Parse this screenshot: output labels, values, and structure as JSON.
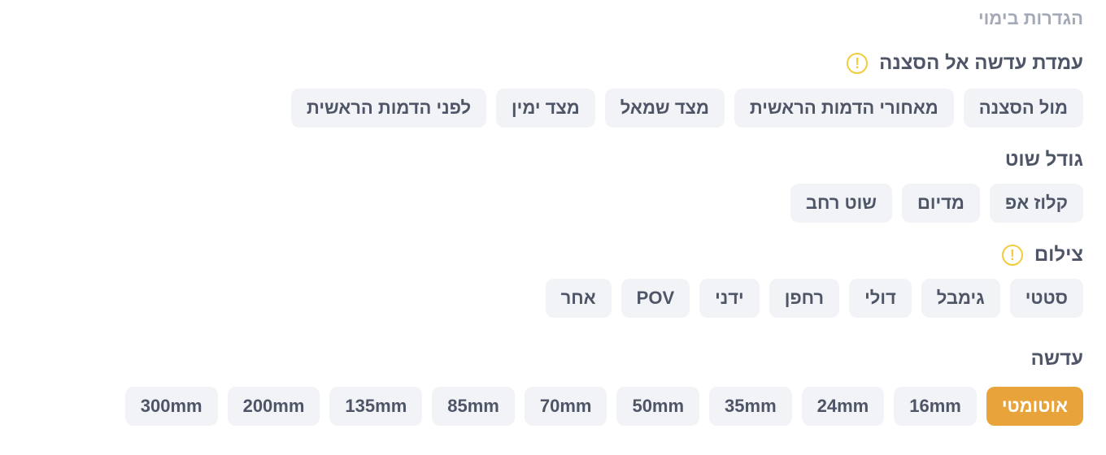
{
  "section_title": "הגדרות בימוי",
  "camera_position": {
    "label": "עמדת עדשה אל הסצנה",
    "warning_icon": "exclamation-circle-icon",
    "options": [
      "מול הסצנה",
      "מאחורי הדמות הראשית",
      "מצד שמאל",
      "מצד ימין",
      "לפני הדמות הראשית"
    ]
  },
  "shot_size": {
    "label": "גודל שוט",
    "options": [
      "קלוז אפ",
      "מדיום",
      "שוט רחב"
    ]
  },
  "filming": {
    "label": "צילום",
    "warning_icon": "exclamation-circle-icon",
    "options": [
      "סטטי",
      "גימבל",
      "דולי",
      "רחפן",
      "ידני",
      "POV",
      "אחר"
    ]
  },
  "lens": {
    "label": "עדשה",
    "selected": "אוטומטי",
    "options": [
      "אוטומטי",
      "16mm",
      "24mm",
      "35mm",
      "50mm",
      "70mm",
      "85mm",
      "135mm",
      "200mm",
      "300mm"
    ]
  },
  "colors": {
    "accent": "#e8a33a",
    "warning": "#f2cc3d",
    "chip_bg": "#f1f3f7"
  }
}
